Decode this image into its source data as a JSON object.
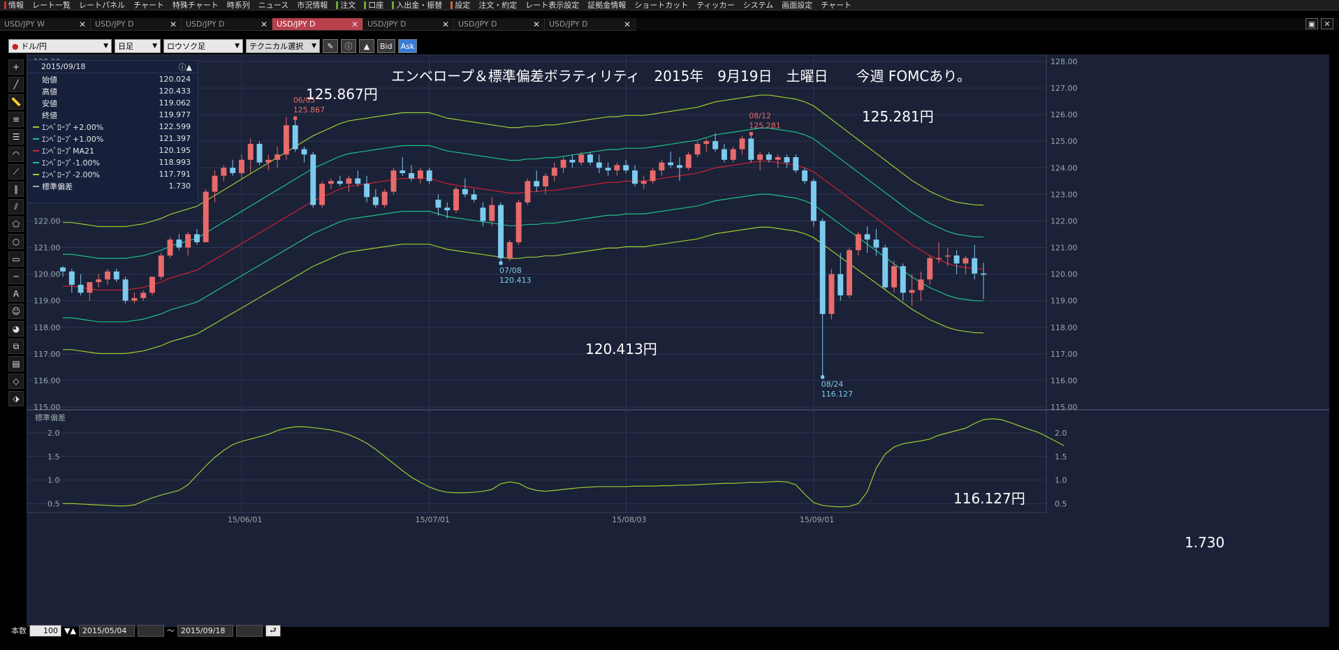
{
  "menu": {
    "items": [
      "情報",
      "レート一覧",
      "レートパネル",
      "チャート",
      "特殊チャート",
      "時系列",
      "ニュース",
      "市況情報",
      "注文",
      "口座",
      "入出金・振替",
      "設定",
      "注文・約定",
      "レート表示設定",
      "証拠金情報",
      "ショートカット",
      "ティッカー",
      "システム",
      "画面設定",
      "チャート"
    ]
  },
  "tabs": [
    {
      "label": "USD/JPY W",
      "active": false
    },
    {
      "label": "USD/JPY D",
      "active": false
    },
    {
      "label": "USD/JPY D",
      "active": false
    },
    {
      "label": "USD/JPY D",
      "active": true
    },
    {
      "label": "USD/JPY D",
      "active": false
    },
    {
      "label": "USD/JPY D",
      "active": false
    },
    {
      "label": "USD/JPY D",
      "active": false
    }
  ],
  "toolbar": {
    "pair": "ドル/円",
    "period": "日足",
    "chart_type": "ロウソク足",
    "technical": "テクニカル選択",
    "bid": "Bid",
    "ask": "Ask"
  },
  "infobox": {
    "date": "2015/09/18",
    "rows": [
      {
        "label": "始値",
        "value": "120.024",
        "color": ""
      },
      {
        "label": "高値",
        "value": "120.433",
        "color": ""
      },
      {
        "label": "安値",
        "value": "119.062",
        "color": ""
      },
      {
        "label": "終値",
        "value": "119.977",
        "color": ""
      },
      {
        "label": "ｴﾝﾍﾞﾛｰﾌﾟ+2.00%",
        "value": "122.599",
        "color": "#9acd32"
      },
      {
        "label": "ｴﾝﾍﾞﾛｰﾌﾟ+1.00%",
        "value": "121.397",
        "color": "#1fc08a"
      },
      {
        "label": "ｴﾝﾍﾞﾛｰﾌﾟMA21",
        "value": "120.195",
        "color": "#cc2233"
      },
      {
        "label": "ｴﾝﾍﾞﾛｰﾌﾟ-1.00%",
        "value": "118.993",
        "color": "#1fc08a"
      },
      {
        "label": "ｴﾝﾍﾞﾛｰﾌﾟ-2.00%",
        "value": "117.791",
        "color": "#9acd32"
      },
      {
        "label": "標準偏差",
        "value": "1.730",
        "color": "#aaaaaa"
      }
    ]
  },
  "annotations": {
    "headline": "エンベロープ＆標準偏差ボラティリティ　2015年　9月19日　土曜日　　今週 FOMCあり。",
    "high1": "125.867円",
    "high2": "125.281円",
    "low1": "120.413円",
    "low2": "116.127円",
    "sd_last": "1.730",
    "m1_date": "06/05",
    "m1_val": "125.867",
    "m2_date": "08/12",
    "m2_val": "125.281",
    "m3_date": "07/08",
    "m3_val": "120.413",
    "m4_date": "08/24",
    "m4_val": "116.127",
    "sub_title": "標準偏差"
  },
  "footer": {
    "count_label": "本数",
    "count": "100",
    "from": "2015/05/04",
    "tilde": "～",
    "to": "2015/09/18"
  },
  "colors": {
    "up": "#e86a6a",
    "down": "#7ccbee",
    "env2": "#9acd32",
    "env1": "#1fc08a",
    "ma": "#cc2233",
    "sd": "#9acd32",
    "bg": "#1b2137"
  },
  "chart_data": {
    "type": "candlestick",
    "x_labels": [
      "15/06/01",
      "15/07/01",
      "15/08/03",
      "15/09/01"
    ],
    "y_ticks": [
      "128.00",
      "127.00",
      "126.00",
      "125.00",
      "124.00",
      "123.00",
      "122.00",
      "121.00",
      "120.00",
      "119.00",
      "118.00",
      "117.00",
      "116.00",
      "115.00"
    ],
    "ylim": [
      115,
      128
    ],
    "sd_ticks": [
      "2.0",
      "1.5",
      "1.0",
      "0.5"
    ],
    "sd_ylim": [
      0.4,
      2.4
    ],
    "ohlc": [
      [
        120.25,
        120.3,
        119.9,
        120.1
      ],
      [
        120.1,
        120.2,
        119.3,
        119.6
      ],
      [
        119.6,
        120.0,
        119.2,
        119.3
      ],
      [
        119.3,
        119.7,
        119.0,
        119.7
      ],
      [
        119.7,
        120.0,
        119.5,
        119.8
      ],
      [
        119.8,
        120.2,
        119.6,
        120.1
      ],
      [
        120.1,
        120.2,
        119.7,
        119.8
      ],
      [
        119.8,
        119.9,
        118.9,
        119.0
      ],
      [
        119.0,
        119.3,
        118.9,
        119.1
      ],
      [
        119.1,
        119.4,
        119.0,
        119.3
      ],
      [
        119.3,
        119.9,
        119.2,
        119.9
      ],
      [
        119.9,
        120.8,
        119.8,
        120.7
      ],
      [
        120.7,
        121.4,
        120.6,
        121.3
      ],
      [
        121.3,
        121.5,
        120.9,
        121.0
      ],
      [
        121.0,
        121.6,
        120.7,
        121.5
      ],
      [
        121.5,
        121.7,
        121.1,
        121.2
      ],
      [
        121.2,
        123.2,
        121.2,
        123.1
      ],
      [
        123.1,
        123.9,
        122.7,
        123.7
      ],
      [
        123.7,
        124.1,
        123.5,
        124.0
      ],
      [
        124.0,
        124.3,
        123.7,
        123.8
      ],
      [
        123.8,
        124.5,
        123.6,
        124.3
      ],
      [
        124.3,
        125.1,
        123.8,
        124.9
      ],
      [
        124.9,
        125.0,
        124.1,
        124.2
      ],
      [
        124.2,
        124.5,
        123.9,
        124.3
      ],
      [
        124.3,
        124.8,
        124.0,
        124.5
      ],
      [
        124.5,
        125.9,
        124.3,
        125.6
      ],
      [
        125.6,
        125.867,
        124.6,
        124.7
      ],
      [
        124.7,
        124.8,
        124.2,
        124.5
      ],
      [
        124.5,
        124.6,
        122.5,
        122.6
      ],
      [
        122.6,
        123.5,
        122.5,
        123.4
      ],
      [
        123.4,
        123.6,
        123.2,
        123.5
      ],
      [
        123.5,
        123.7,
        123.3,
        123.4
      ],
      [
        123.4,
        123.7,
        123.1,
        123.6
      ],
      [
        123.6,
        123.9,
        123.3,
        123.4
      ],
      [
        123.4,
        123.7,
        122.7,
        122.9
      ],
      [
        122.9,
        123.2,
        122.5,
        122.6
      ],
      [
        122.6,
        123.2,
        122.5,
        123.1
      ],
      [
        123.1,
        124.0,
        123.0,
        123.9
      ],
      [
        123.9,
        124.4,
        123.7,
        123.8
      ],
      [
        123.8,
        124.1,
        123.5,
        123.6
      ],
      [
        123.6,
        124.0,
        123.4,
        123.9
      ],
      [
        123.9,
        124.0,
        123.4,
        123.5
      ],
      [
        122.8,
        123.0,
        122.2,
        122.5
      ],
      [
        122.5,
        122.7,
        122.1,
        122.4
      ],
      [
        122.4,
        123.3,
        122.3,
        123.2
      ],
      [
        123.2,
        123.6,
        122.9,
        123.0
      ],
      [
        123.0,
        123.2,
        122.7,
        122.8
      ],
      [
        122.5,
        122.7,
        121.8,
        122.0
      ],
      [
        122.0,
        122.9,
        121.8,
        122.6
      ],
      [
        122.6,
        122.7,
        120.413,
        120.6
      ],
      [
        120.6,
        121.3,
        120.5,
        121.2
      ],
      [
        121.2,
        122.8,
        121.1,
        122.7
      ],
      [
        122.7,
        123.6,
        122.6,
        123.5
      ],
      [
        123.5,
        123.9,
        123.1,
        123.3
      ],
      [
        123.3,
        123.8,
        123.0,
        123.7
      ],
      [
        123.7,
        124.2,
        123.5,
        124.0
      ],
      [
        124.0,
        124.4,
        123.8,
        124.3
      ],
      [
        124.3,
        124.5,
        124.0,
        124.2
      ],
      [
        124.2,
        124.6,
        124.1,
        124.5
      ],
      [
        124.5,
        124.6,
        124.1,
        124.2
      ],
      [
        124.2,
        124.5,
        123.8,
        124.0
      ],
      [
        124.0,
        124.2,
        123.7,
        123.9
      ],
      [
        123.9,
        124.2,
        123.7,
        124.1
      ],
      [
        124.1,
        124.3,
        123.8,
        123.9
      ],
      [
        123.9,
        124.1,
        123.3,
        123.4
      ],
      [
        123.4,
        123.7,
        123.2,
        123.5
      ],
      [
        123.5,
        124.0,
        123.4,
        123.9
      ],
      [
        123.9,
        124.3,
        123.7,
        124.2
      ],
      [
        124.2,
        124.6,
        124.0,
        124.1
      ],
      [
        124.1,
        124.4,
        123.5,
        124.0
      ],
      [
        124.0,
        124.6,
        123.9,
        124.5
      ],
      [
        124.5,
        125.0,
        124.4,
        124.9
      ],
      [
        124.9,
        125.1,
        124.6,
        125.0
      ],
      [
        125.0,
        125.3,
        124.6,
        124.7
      ],
      [
        124.7,
        124.9,
        124.2,
        124.3
      ],
      [
        124.3,
        124.8,
        124.2,
        124.7
      ],
      [
        124.7,
        125.2,
        124.5,
        125.1
      ],
      [
        125.1,
        125.281,
        124.2,
        124.3
      ],
      [
        124.3,
        124.6,
        123.9,
        124.5
      ],
      [
        124.5,
        124.6,
        124.2,
        124.3
      ],
      [
        124.3,
        124.5,
        124.0,
        124.4
      ],
      [
        124.4,
        124.5,
        124.0,
        124.2
      ],
      [
        124.4,
        124.5,
        123.8,
        123.9
      ],
      [
        123.9,
        124.0,
        123.4,
        123.5
      ],
      [
        123.5,
        123.6,
        121.8,
        122.0
      ],
      [
        122.0,
        122.1,
        116.127,
        118.5
      ],
      [
        118.5,
        120.2,
        118.3,
        120.0
      ],
      [
        120.0,
        120.8,
        119.0,
        119.2
      ],
      [
        119.2,
        121.0,
        119.1,
        120.9
      ],
      [
        120.9,
        121.6,
        120.7,
        121.5
      ],
      [
        121.5,
        121.8,
        120.8,
        121.3
      ],
      [
        121.3,
        121.7,
        120.7,
        121.0
      ],
      [
        121.0,
        121.1,
        119.4,
        119.5
      ],
      [
        119.5,
        120.5,
        119.3,
        120.3
      ],
      [
        120.3,
        120.4,
        119.0,
        119.3
      ],
      [
        119.3,
        120.0,
        118.8,
        119.4
      ],
      [
        119.4,
        120.1,
        119.0,
        119.8
      ],
      [
        119.8,
        120.7,
        119.6,
        120.6
      ],
      [
        120.6,
        121.2,
        120.4,
        120.6
      ],
      [
        120.7,
        121.0,
        120.3,
        120.7
      ],
      [
        120.7,
        120.9,
        120.0,
        120.4
      ],
      [
        120.4,
        120.7,
        120.0,
        120.6
      ],
      [
        120.6,
        121.1,
        119.8,
        120.02
      ],
      [
        120.024,
        120.433,
        119.062,
        119.977
      ]
    ],
    "ma": [
      119.55,
      119.55,
      119.5,
      119.45,
      119.4,
      119.4,
      119.4,
      119.4,
      119.45,
      119.5,
      119.6,
      119.7,
      119.85,
      119.95,
      120.05,
      120.15,
      120.35,
      120.55,
      120.75,
      120.95,
      121.15,
      121.35,
      121.55,
      121.75,
      121.95,
      122.15,
      122.35,
      122.55,
      122.75,
      122.9,
      123.05,
      123.2,
      123.3,
      123.35,
      123.4,
      123.45,
      123.5,
      123.55,
      123.6,
      123.6,
      123.6,
      123.6,
      123.5,
      123.4,
      123.35,
      123.3,
      123.25,
      123.2,
      123.15,
      123.1,
      123.05,
      123.05,
      123.1,
      123.1,
      123.15,
      123.15,
      123.2,
      123.25,
      123.3,
      123.35,
      123.4,
      123.45,
      123.45,
      123.5,
      123.5,
      123.5,
      123.55,
      123.6,
      123.65,
      123.7,
      123.75,
      123.8,
      123.9,
      124.0,
      124.05,
      124.1,
      124.15,
      124.2,
      124.25,
      124.25,
      124.2,
      124.15,
      124.1,
      124.0,
      123.85,
      123.6,
      123.35,
      123.1,
      122.85,
      122.6,
      122.35,
      122.1,
      121.85,
      121.6,
      121.35,
      121.1,
      120.9,
      120.7,
      120.55,
      120.4,
      120.3,
      120.25,
      120.2,
      120.195
    ],
    "sd": [
      0.5,
      0.5,
      0.49,
      0.48,
      0.47,
      0.46,
      0.45,
      0.45,
      0.47,
      0.55,
      0.62,
      0.68,
      0.73,
      0.78,
      0.9,
      1.1,
      1.3,
      1.48,
      1.63,
      1.75,
      1.82,
      1.87,
      1.92,
      1.97,
      2.05,
      2.1,
      2.13,
      2.13,
      2.11,
      2.09,
      2.06,
      2.02,
      1.96,
      1.88,
      1.78,
      1.65,
      1.5,
      1.35,
      1.2,
      1.06,
      0.95,
      0.85,
      0.78,
      0.74,
      0.73,
      0.73,
      0.74,
      0.76,
      0.8,
      0.92,
      0.96,
      0.93,
      0.83,
      0.78,
      0.76,
      0.78,
      0.8,
      0.82,
      0.84,
      0.85,
      0.86,
      0.86,
      0.86,
      0.86,
      0.87,
      0.87,
      0.87,
      0.88,
      0.88,
      0.89,
      0.89,
      0.9,
      0.91,
      0.92,
      0.93,
      0.93,
      0.94,
      0.95,
      0.95,
      0.96,
      0.97,
      0.96,
      0.9,
      0.7,
      0.52,
      0.46,
      0.44,
      0.43,
      0.44,
      0.5,
      0.75,
      1.25,
      1.55,
      1.7,
      1.77,
      1.8,
      1.83,
      1.87,
      1.95,
      2.0,
      2.05,
      2.1,
      2.2,
      2.28,
      2.3,
      2.28,
      2.22,
      2.15,
      2.08,
      2.02,
      1.93,
      1.83,
      1.73
    ]
  }
}
